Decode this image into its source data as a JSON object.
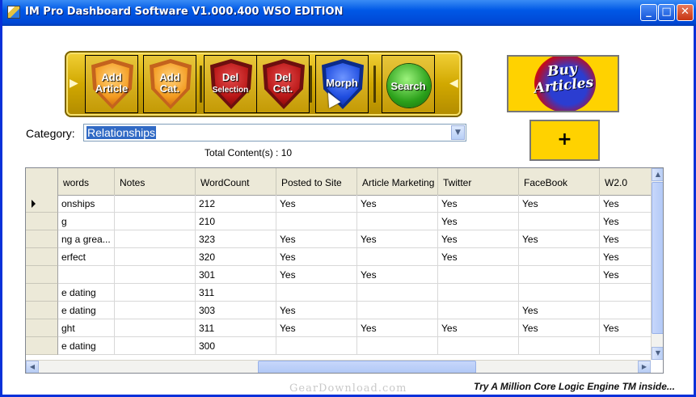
{
  "window": {
    "title": "IM Pro Dashboard Software V1.000.400 WSO EDITION",
    "min_glyph": "_",
    "max_glyph": "□",
    "close_glyph": "✕"
  },
  "toolbar": {
    "buttons": [
      {
        "label": "Add Article",
        "line1": "Add",
        "line2": "Article",
        "color": "orange"
      },
      {
        "label": "Add Cat.",
        "line1": "Add",
        "line2": "Cat.",
        "color": "orange"
      },
      {
        "label": "Del Selection",
        "line1": "Del",
        "line2": "Selection",
        "color": "red"
      },
      {
        "label": "Del Cat.",
        "line1": "Del",
        "line2": "Cat.",
        "color": "red"
      },
      {
        "label": "Morph",
        "line1": "Morph",
        "line2": "",
        "color": "blue"
      },
      {
        "label": "Search",
        "line1": "Search",
        "line2": "",
        "color": "green"
      }
    ]
  },
  "buy_button": {
    "line1": "Buy",
    "line2": "Articles"
  },
  "plus_button": {
    "label": "+"
  },
  "category": {
    "label": "Category:",
    "value": "Relationships",
    "arrow": "▼"
  },
  "total": "Total Content(s) : 10",
  "grid": {
    "columns": [
      "words",
      "Notes",
      "WordCount",
      "Posted to Site",
      "Article Marketing",
      "Twitter",
      "FaceBook",
      "W2.0"
    ],
    "rows": [
      [
        "onships",
        "",
        "212",
        "Yes",
        "Yes",
        "Yes",
        "Yes",
        "Yes"
      ],
      [
        "g",
        "",
        "210",
        "",
        "",
        "Yes",
        "",
        "Yes"
      ],
      [
        "ng a grea...",
        "",
        "323",
        "Yes",
        "Yes",
        "Yes",
        "Yes",
        "Yes"
      ],
      [
        "erfect",
        "",
        "320",
        "Yes",
        "",
        "Yes",
        "",
        "Yes"
      ],
      [
        "",
        "",
        "301",
        "Yes",
        "Yes",
        "",
        "",
        "Yes"
      ],
      [
        "e dating",
        "",
        "311",
        "",
        "",
        "",
        "",
        ""
      ],
      [
        "e dating",
        "",
        "303",
        "Yes",
        "",
        "",
        "Yes",
        ""
      ],
      [
        "ght",
        "",
        "311",
        "Yes",
        "Yes",
        "Yes",
        "Yes",
        "Yes"
      ],
      [
        "e dating",
        "",
        "300",
        "",
        "",
        "",
        "",
        ""
      ]
    ]
  },
  "watermark": "GearDownload.com",
  "footer": "Try A Million Core Logic Engine TM inside..."
}
